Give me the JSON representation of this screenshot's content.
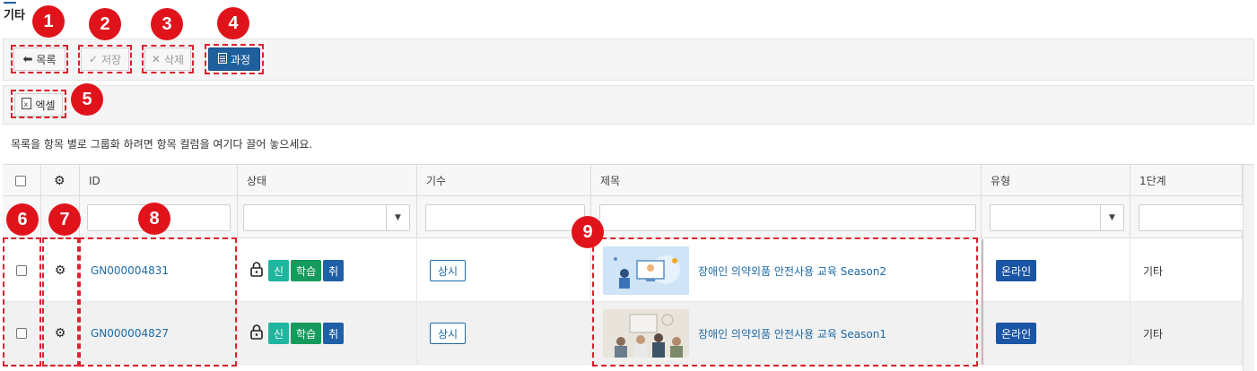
{
  "page": {
    "title": "기타"
  },
  "toolbar": {
    "list_label": "목록",
    "save_label": "저장",
    "delete_label": "삭제",
    "course_label": "과정"
  },
  "toolbar2": {
    "excel_label": "엑셀"
  },
  "group_hint": "목록을 항목 별로 그룹화 하려면 항목 컬럼을 여기다 끌어 놓으세요.",
  "callouts": [
    "1",
    "2",
    "3",
    "4",
    "5",
    "6",
    "7",
    "8",
    "9"
  ],
  "grid": {
    "columns": {
      "id": "ID",
      "status": "상태",
      "period": "기수",
      "title": "제목",
      "type": "유형",
      "level1": "1단계"
    },
    "rows": [
      {
        "id": "GN000004831",
        "status_badges": [
          "신",
          "학습",
          "취"
        ],
        "period": "상시",
        "title": "장애인 의약외품 안전사용 교육 Season2",
        "type": "온라인",
        "level1": "기타"
      },
      {
        "id": "GN000004827",
        "status_badges": [
          "신",
          "학습",
          "취"
        ],
        "period": "상시",
        "title": "장애인 의약외품 안전사용 교육 Season1",
        "type": "온라인",
        "level1": "기타"
      }
    ]
  },
  "colors": {
    "callout": "#e0131b",
    "primary": "#1f5f9e",
    "link": "#1f6aa5",
    "badge_new": "#1fb59f",
    "badge_study": "#179a5d",
    "badge_cancel": "#1f5fa8"
  }
}
